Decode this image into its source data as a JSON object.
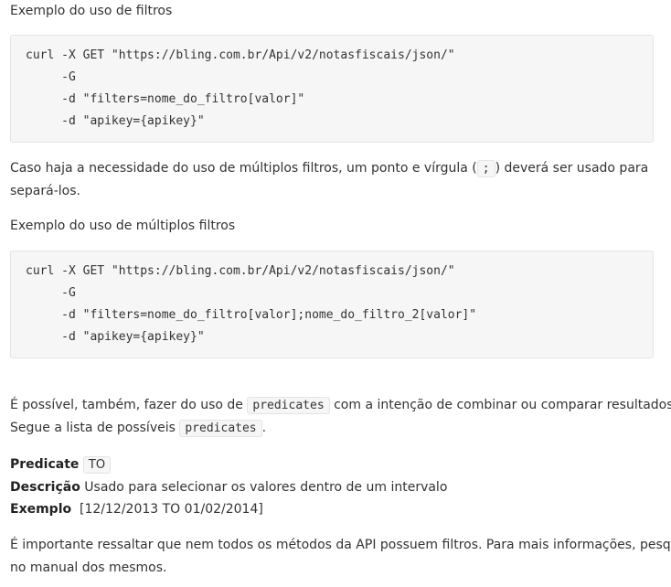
{
  "heading_filter_example": "Exemplo do uso de filtros",
  "code_block_1": [
    "curl -X GET \"https://bling.com.br/Api/v2/notasfiscais/json/\"",
    "     -G",
    "     -d \"filters=nome_do_filtro[valor]\"",
    "     -d \"apikey={apikey}\""
  ],
  "multi_filter_text": {
    "line1_before": "Caso haja a necessidade do uso de múltiplos filtros, um ponto e vírgula (",
    "separator_code": ";",
    "line1_after": ") deverá ser usado para",
    "line2": "separá-los."
  },
  "heading_multi_filter_example": "Exemplo do uso de múltiplos filtros",
  "code_block_2": [
    "curl -X GET \"https://bling.com.br/Api/v2/notasfiscais/json/\"",
    "     -G",
    "     -d \"filters=nome_do_filtro[valor];nome_do_filtro_2[valor]\"",
    "     -d \"apikey={apikey}\""
  ],
  "predicates_text": {
    "line1_before": "É possível, também, fazer do uso de",
    "code1": "predicates",
    "line1_after": "com a intenção de combinar ou comparar resultados.",
    "line2_before": "Segue a lista de possíveis",
    "code2": "predicates",
    "line2_after": "."
  },
  "predicate_def": {
    "predicate_label": "Predicate",
    "predicate_value": "TO",
    "description_label": "Descrição",
    "description_value": "Usado para selecionar os valores dentro de um intervalo",
    "example_label": "Exemplo",
    "example_value": "[12/12/2013 TO 01/02/2014]"
  },
  "note_text": {
    "line1": "É importante ressaltar que nem todos os métodos da API possuem filtros. Para mais informações, pesquise",
    "line2": "no manual dos mesmos."
  }
}
